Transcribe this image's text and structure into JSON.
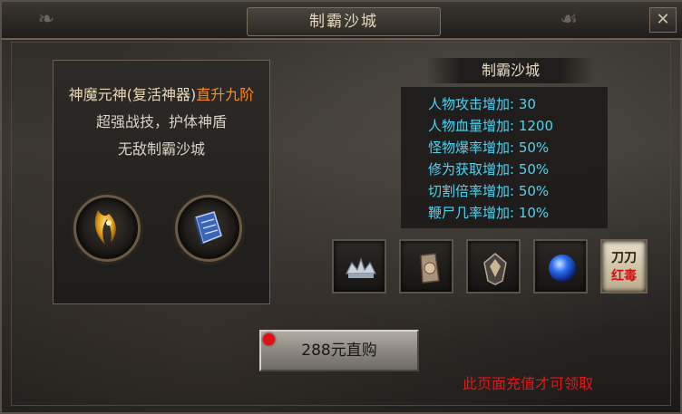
{
  "window": {
    "title": "制霸沙城"
  },
  "left_panel": {
    "line1_prefix": "神魔元神(复活神器)",
    "line1_highlight": "直升九阶",
    "line2": "超强战技，护体神盾",
    "line3": "无敌制霸沙城",
    "orbs": [
      {
        "icon": "golden-blade-icon"
      },
      {
        "icon": "blue-book-icon"
      }
    ]
  },
  "stats": {
    "title": "制霸沙城",
    "rows": [
      {
        "label": "人物攻击增加:",
        "value": "30"
      },
      {
        "label": "人物血量增加:",
        "value": "1200"
      },
      {
        "label": "怪物爆率增加:",
        "value": "50%"
      },
      {
        "label": "修为获取增加:",
        "value": "50%"
      },
      {
        "label": "切割倍率增加:",
        "value": "50%"
      },
      {
        "label": "鞭尸几率增加:",
        "value": "10%"
      }
    ]
  },
  "rewards": {
    "items": [
      {
        "icon": "silver-crown-icon"
      },
      {
        "icon": "bronze-token-icon"
      },
      {
        "icon": "dark-crest-icon"
      },
      {
        "icon": "blue-orb-icon"
      },
      {
        "icon": "text-badge-icon",
        "line1": "刀刀",
        "line2": "红毒"
      }
    ]
  },
  "purchase": {
    "button_label": "288元直购",
    "notice": "此页面充值才可领取"
  },
  "colors": {
    "highlight": "#ff8a1a",
    "stat": "#4fd3f2",
    "notice": "#e81515"
  }
}
